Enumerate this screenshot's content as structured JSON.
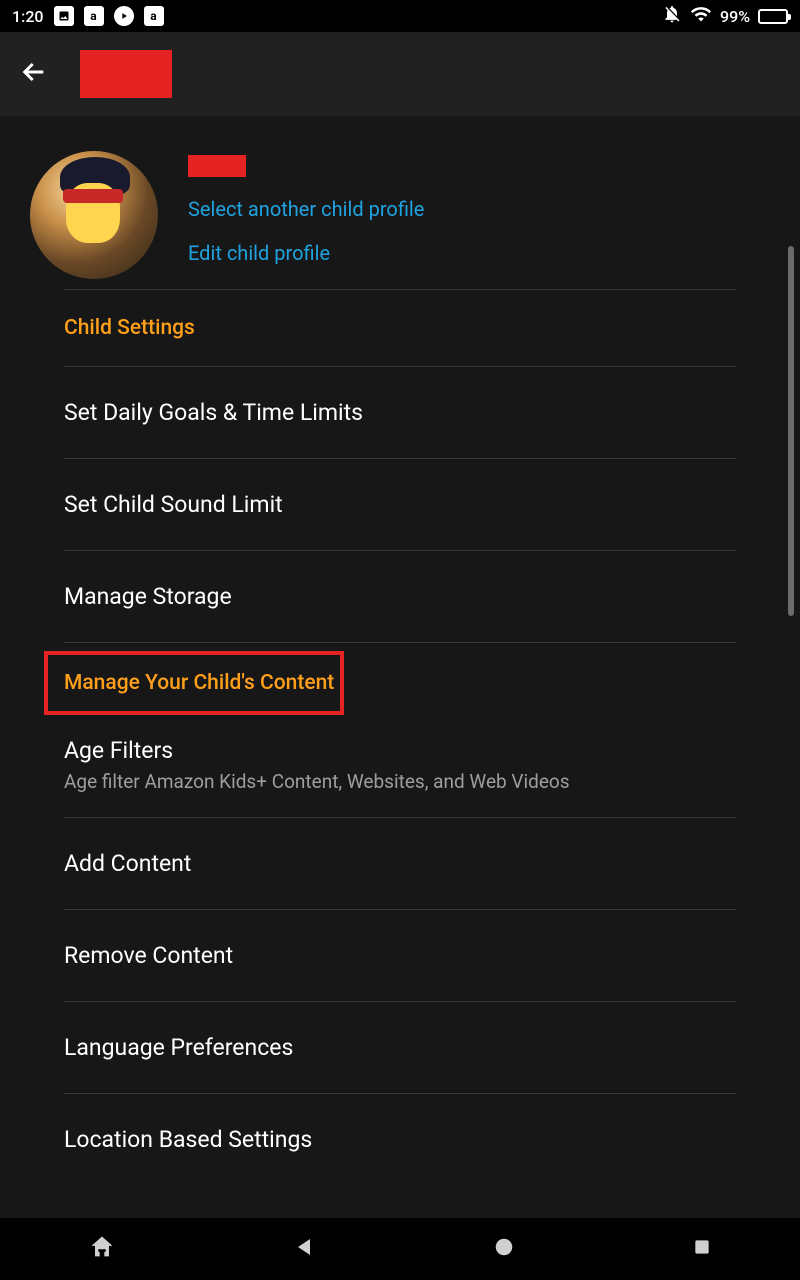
{
  "status": {
    "time": "1:20",
    "battery_pct": "99%"
  },
  "profile": {
    "select_another_label": "Select another child profile",
    "edit_label": "Edit child profile"
  },
  "sections": {
    "child_settings": {
      "header": "Child Settings",
      "items": [
        {
          "title": "Set Daily Goals & Time Limits"
        },
        {
          "title": "Set Child Sound Limit"
        },
        {
          "title": "Manage Storage"
        }
      ]
    },
    "manage_content": {
      "header": "Manage Your Child's Content",
      "items": [
        {
          "title": "Age Filters",
          "sub": "Age filter Amazon Kids+ Content, Websites, and Web Videos"
        },
        {
          "title": "Add Content"
        },
        {
          "title": "Remove Content"
        },
        {
          "title": "Language Preferences"
        },
        {
          "title": "Location Based Settings"
        }
      ]
    }
  }
}
